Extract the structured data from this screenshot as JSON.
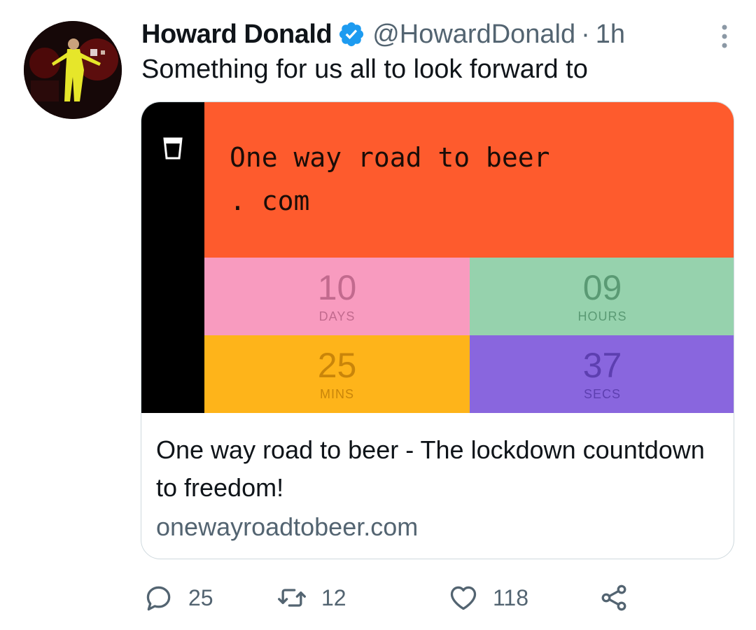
{
  "tweet": {
    "author_name": "Howard Donald",
    "handle": "@HowardDonald",
    "separator": "·",
    "time": "1h",
    "text": "Something for us all to look forward to"
  },
  "card": {
    "banner_text": "One way road to beer\n. com",
    "countdown": [
      {
        "value": "10",
        "unit": "DAYS"
      },
      {
        "value": "09",
        "unit": "HOURS"
      },
      {
        "value": "25",
        "unit": "MINS"
      },
      {
        "value": "37",
        "unit": "SECS"
      }
    ],
    "title": "One way road to beer - The lockdown countdown to freedom!",
    "domain": "onewayroadtobeer.com",
    "colors": {
      "banner": "#fe5b2d",
      "days": "#f89bbf",
      "hours": "#96d2ad",
      "mins": "#feb41a",
      "secs": "#8966de"
    }
  },
  "actions": {
    "reply_count": "25",
    "retweet_count": "12",
    "like_count": "118"
  },
  "icons": [
    "verified-badge-icon",
    "more-options-icon",
    "pint-glass-icon",
    "reply-icon",
    "retweet-icon",
    "like-icon",
    "share-icon"
  ]
}
